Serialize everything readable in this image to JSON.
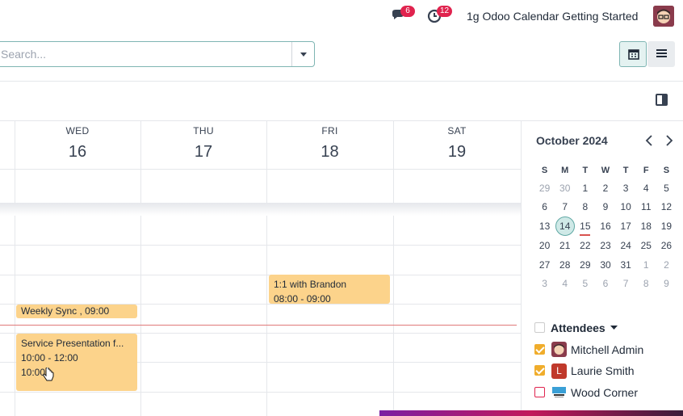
{
  "navbar": {
    "chat_badge": "6",
    "activity_badge": "12",
    "company": "1g Odoo Calendar Getting Started"
  },
  "search": {
    "placeholder": "Search..."
  },
  "calendar": {
    "days": [
      {
        "name": "WED",
        "num": "16"
      },
      {
        "name": "THU",
        "num": "17"
      },
      {
        "name": "FRI",
        "num": "18"
      },
      {
        "name": "SAT",
        "num": "19"
      }
    ],
    "events": {
      "brandon": {
        "title": "1:1 with Brandon",
        "time": "08:00 - 09:00"
      },
      "weekly": {
        "title": "Weekly Sync , 09:00"
      },
      "service": {
        "title": "Service Presentation f...",
        "time": "10:00 - 12:00",
        "extra": "10:00"
      }
    }
  },
  "sidebar": {
    "month": "October 2024",
    "weekdays": [
      "S",
      "M",
      "T",
      "W",
      "T",
      "F",
      "S"
    ],
    "weeks": [
      [
        "29",
        "30",
        "1",
        "2",
        "3",
        "4",
        "5"
      ],
      [
        "6",
        "7",
        "8",
        "9",
        "10",
        "11",
        "12"
      ],
      [
        "13",
        "14",
        "15",
        "16",
        "17",
        "18",
        "19"
      ],
      [
        "20",
        "21",
        "22",
        "23",
        "24",
        "25",
        "26"
      ],
      [
        "27",
        "28",
        "29",
        "30",
        "31",
        "1",
        "2"
      ],
      [
        "3",
        "4",
        "5",
        "6",
        "7",
        "8",
        "9"
      ]
    ],
    "today": "14",
    "attendees_label": "Attendees",
    "attendees": [
      {
        "name": "Mitchell Admin",
        "checked": true
      },
      {
        "name": "Laurie Smith",
        "checked": true,
        "initial": "L"
      },
      {
        "name": "Wood Corner",
        "checked": false
      }
    ]
  },
  "colors": {
    "accent": "#7fb5b3",
    "event": "#fcd38b",
    "now_line": "#e07a7a",
    "badge": "#e0234e"
  }
}
